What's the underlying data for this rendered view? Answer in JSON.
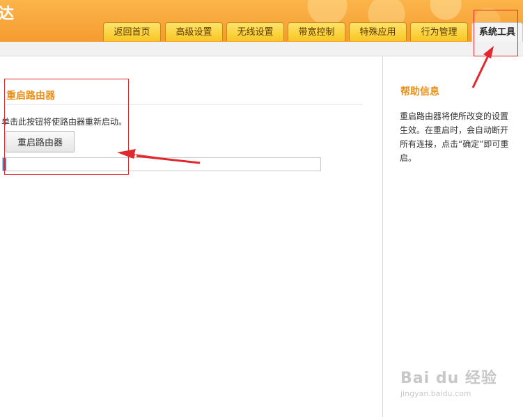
{
  "header": {
    "logo_text": "达"
  },
  "tabs": [
    {
      "label": "返回首页",
      "active": false
    },
    {
      "label": "高级设置",
      "active": false
    },
    {
      "label": "无线设置",
      "active": false
    },
    {
      "label": "带宽控制",
      "active": false
    },
    {
      "label": "特殊应用",
      "active": false
    },
    {
      "label": "行为管理",
      "active": false
    },
    {
      "label": "系统工具",
      "active": true
    }
  ],
  "main": {
    "section_title": "重启路由器",
    "description": "单击此按钮将使路由器重新启动。",
    "reboot_button_label": "重启路由器",
    "progress_fraction": 0.01
  },
  "help": {
    "title": "帮助信息",
    "body": "重启路由器将使所改变的设置生效。在重启时，会自动断开所有连接，点击“确定”即可重启。"
  },
  "watermark": {
    "main": "Bai du 经验",
    "sub": "jingyan.baidu.com"
  },
  "colors": {
    "accent": "#e8901a",
    "header_orange": "#f7a43a",
    "tab_yellow": "#f8c623",
    "annotation_red": "#e0282e",
    "progress_blue": "#4a7fb5"
  }
}
